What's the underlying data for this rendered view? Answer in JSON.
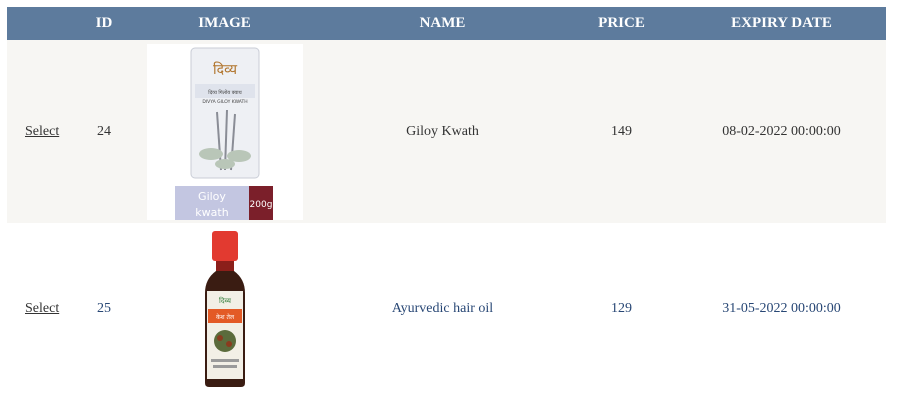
{
  "table": {
    "headers": [
      "",
      "ID",
      "IMAGE",
      "NAME",
      "PRICE",
      "EXPIRY DATE"
    ],
    "rows": [
      {
        "select_label": "Select",
        "id": "24",
        "image_icon": "giloy-kwath-pack",
        "image_texts": [
          "दिव्य",
          "दिव्य गिलोय क्वाथ",
          "DIVYA GILOY KWATH",
          "Giloy",
          "kwath",
          "200g"
        ],
        "name": "Giloy Kwath",
        "price": "149",
        "expiry_date": "08-02-2022 00:00:00"
      },
      {
        "select_label": "Select",
        "id": "25",
        "image_icon": "hair-oil-bottle",
        "image_texts": [
          "दिव्य",
          "केश तेल"
        ],
        "name": "Ayurvedic hair oil",
        "price": "129",
        "expiry_date": "31-05-2022 00:00:00"
      }
    ]
  },
  "colors": {
    "header_bg": "#5d7b9d",
    "row_bg_alt": "#f7f6f3",
    "row_text": "#333333",
    "row_text_alt": "#284775"
  }
}
